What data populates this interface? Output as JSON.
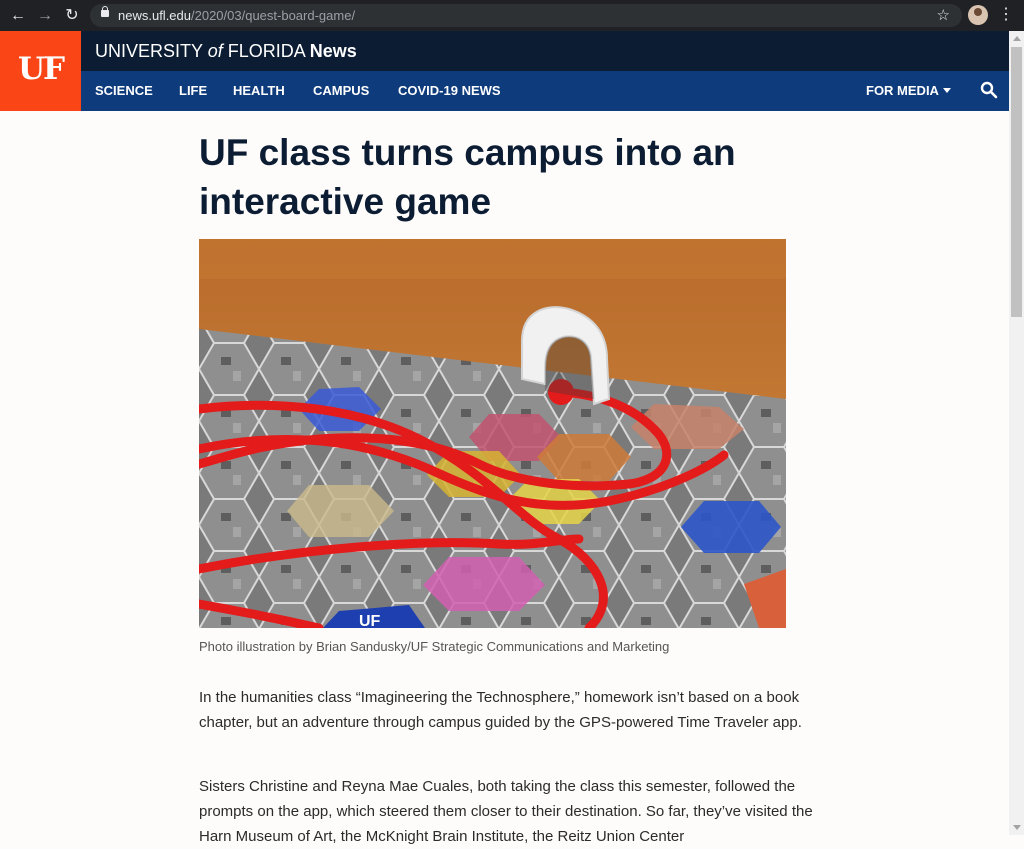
{
  "browser": {
    "url_host": "news.ufl.edu",
    "url_path": "/2020/03/quest-board-game/"
  },
  "site": {
    "logo_text": "UF",
    "title_prefix": "UNIVERSITY",
    "title_of": "of",
    "title_suffix": "FLORIDA",
    "title_news": "News"
  },
  "nav": {
    "items": [
      "SCIENCE",
      "LIFE",
      "HEALTH",
      "CAMPUS",
      "COVID-19 NEWS"
    ],
    "for_media": "FOR MEDIA"
  },
  "article": {
    "headline": "UF class turns campus into an interactive game",
    "image_board_text": "UF",
    "caption": "Photo illustration by Brian Sandusky/UF Strategic Communications and Marketing",
    "paragraphs": [
      "In the humanities class “Imagineering the Technosphere,” homework isn’t based on a book chapter, but an adventure through campus guided by the GPS-powered Time Traveler app.",
      "Sisters Christine and Reyna Mae Cuales, both taking the class this semester, followed the prompts on the app, which steered them closer to their destination. So far, they’ve visited the Harn Museum of Art, the McKnight Brain Institute, the Reitz Union Center"
    ]
  },
  "colors": {
    "brand_orange": "#fa4616",
    "brand_navy": "#0b1c33",
    "nav_blue": "#0e3b7c"
  }
}
